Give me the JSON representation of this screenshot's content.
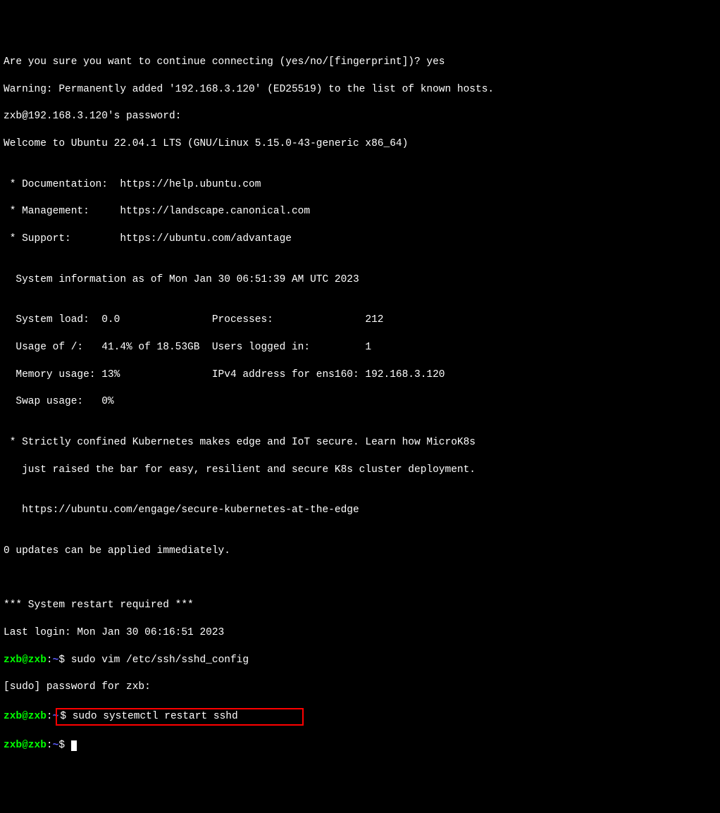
{
  "lines": {
    "l0": "Are you sure you want to continue connecting (yes/no/[fingerprint])? yes",
    "l1": "Warning: Permanently added '192.168.3.120' (ED25519) to the list of known hosts.",
    "l2": "zxb@192.168.3.120's password:",
    "l3": "Welcome to Ubuntu 22.04.1 LTS (GNU/Linux 5.15.0-43-generic x86_64)",
    "l4": "",
    "l5": " * Documentation:  https://help.ubuntu.com",
    "l6": " * Management:     https://landscape.canonical.com",
    "l7": " * Support:        https://ubuntu.com/advantage",
    "l8": "",
    "l9": "  System information as of Mon Jan 30 06:51:39 AM UTC 2023",
    "l10": "",
    "l11": "  System load:  0.0               Processes:               212",
    "l12": "  Usage of /:   41.4% of 18.53GB  Users logged in:         1",
    "l13": "  Memory usage: 13%               IPv4 address for ens160: 192.168.3.120",
    "l14": "  Swap usage:   0%",
    "l15": "",
    "l16": " * Strictly confined Kubernetes makes edge and IoT secure. Learn how MicroK8s",
    "l17": "   just raised the bar for easy, resilient and secure K8s cluster deployment.",
    "l18": "",
    "l19": "   https://ubuntu.com/engage/secure-kubernetes-at-the-edge",
    "l20": "",
    "l21": "0 updates can be applied immediately.",
    "l22": "",
    "l23": "",
    "l24": "*** System restart required ***",
    "l25": "Last login: Mon Jan 30 06:16:51 2023"
  },
  "prompts": {
    "userhost": "zxb@zxb",
    "sep": ":",
    "path": "~",
    "char": "$ "
  },
  "commands": {
    "cmd1": "sudo vim /etc/ssh/sshd_config",
    "sudo_prompt": "[sudo] password for zxb:",
    "cmd2": "sudo systemctl restart sshd",
    "cmd3": ""
  }
}
